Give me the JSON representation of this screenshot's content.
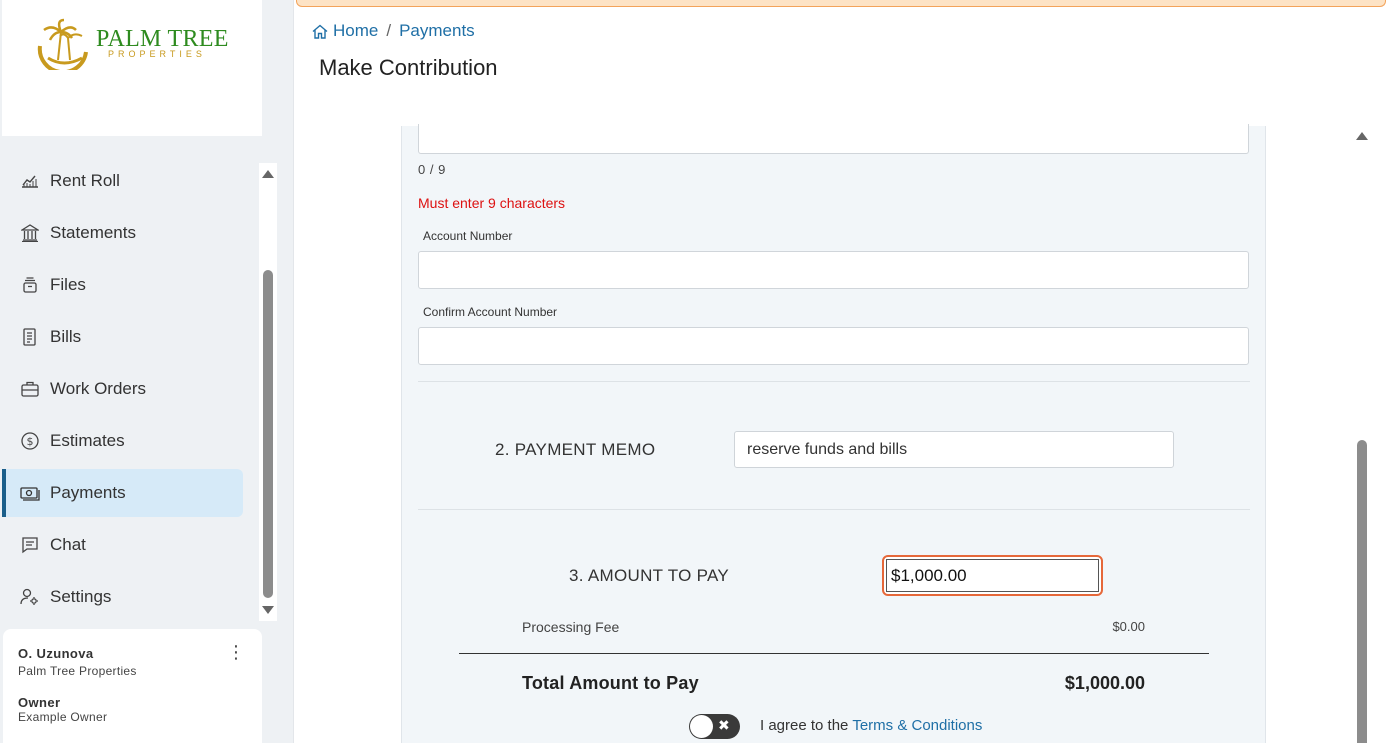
{
  "brand": {
    "name": "PALM TREE",
    "subtitle": "PROPERTIES",
    "colors": {
      "green": "#2e8b1f",
      "gold": "#c89a1e"
    }
  },
  "sidebar": {
    "items": [
      {
        "label": "Rent Roll",
        "icon": "chart-line-icon"
      },
      {
        "label": "Statements",
        "icon": "bank-icon"
      },
      {
        "label": "Files",
        "icon": "archive-icon"
      },
      {
        "label": "Bills",
        "icon": "receipt-icon"
      },
      {
        "label": "Work Orders",
        "icon": "briefcase-icon"
      },
      {
        "label": "Estimates",
        "icon": "dollar-circle-icon"
      },
      {
        "label": "Payments",
        "icon": "cash-icon",
        "active": true
      },
      {
        "label": "Chat",
        "icon": "chat-icon"
      },
      {
        "label": "Settings",
        "icon": "user-settings-icon"
      }
    ],
    "user": {
      "name": "O. Uzunova",
      "company": "Palm Tree Properties",
      "role": "Owner",
      "role_desc": "Example Owner"
    }
  },
  "breadcrumb": {
    "home": "Home",
    "separator": "/",
    "current": "Payments"
  },
  "page": {
    "title": "Make Contribution"
  },
  "form": {
    "routing_counter": "0 / 9",
    "routing_error": "Must enter 9 characters",
    "account_number_label": "Account Number",
    "confirm_account_number_label": "Confirm Account Number",
    "memo_label": "2. PAYMENT MEMO",
    "memo_value": "reserve funds and bills",
    "amount_label": "3. AMOUNT TO PAY",
    "amount_value": "$1,000.00",
    "processing_fee_label": "Processing Fee",
    "processing_fee_value": "$0.00",
    "total_label": "Total Amount to Pay",
    "total_value": "$1,000.00",
    "agree_text": "I agree to the",
    "terms_link": "Terms & Conditions",
    "agree_toggle_on": false
  },
  "colors": {
    "accent": "#1f6fa6",
    "error": "#dd1111",
    "focus": "#e6683a",
    "active_nav": "#d6eaf8"
  }
}
